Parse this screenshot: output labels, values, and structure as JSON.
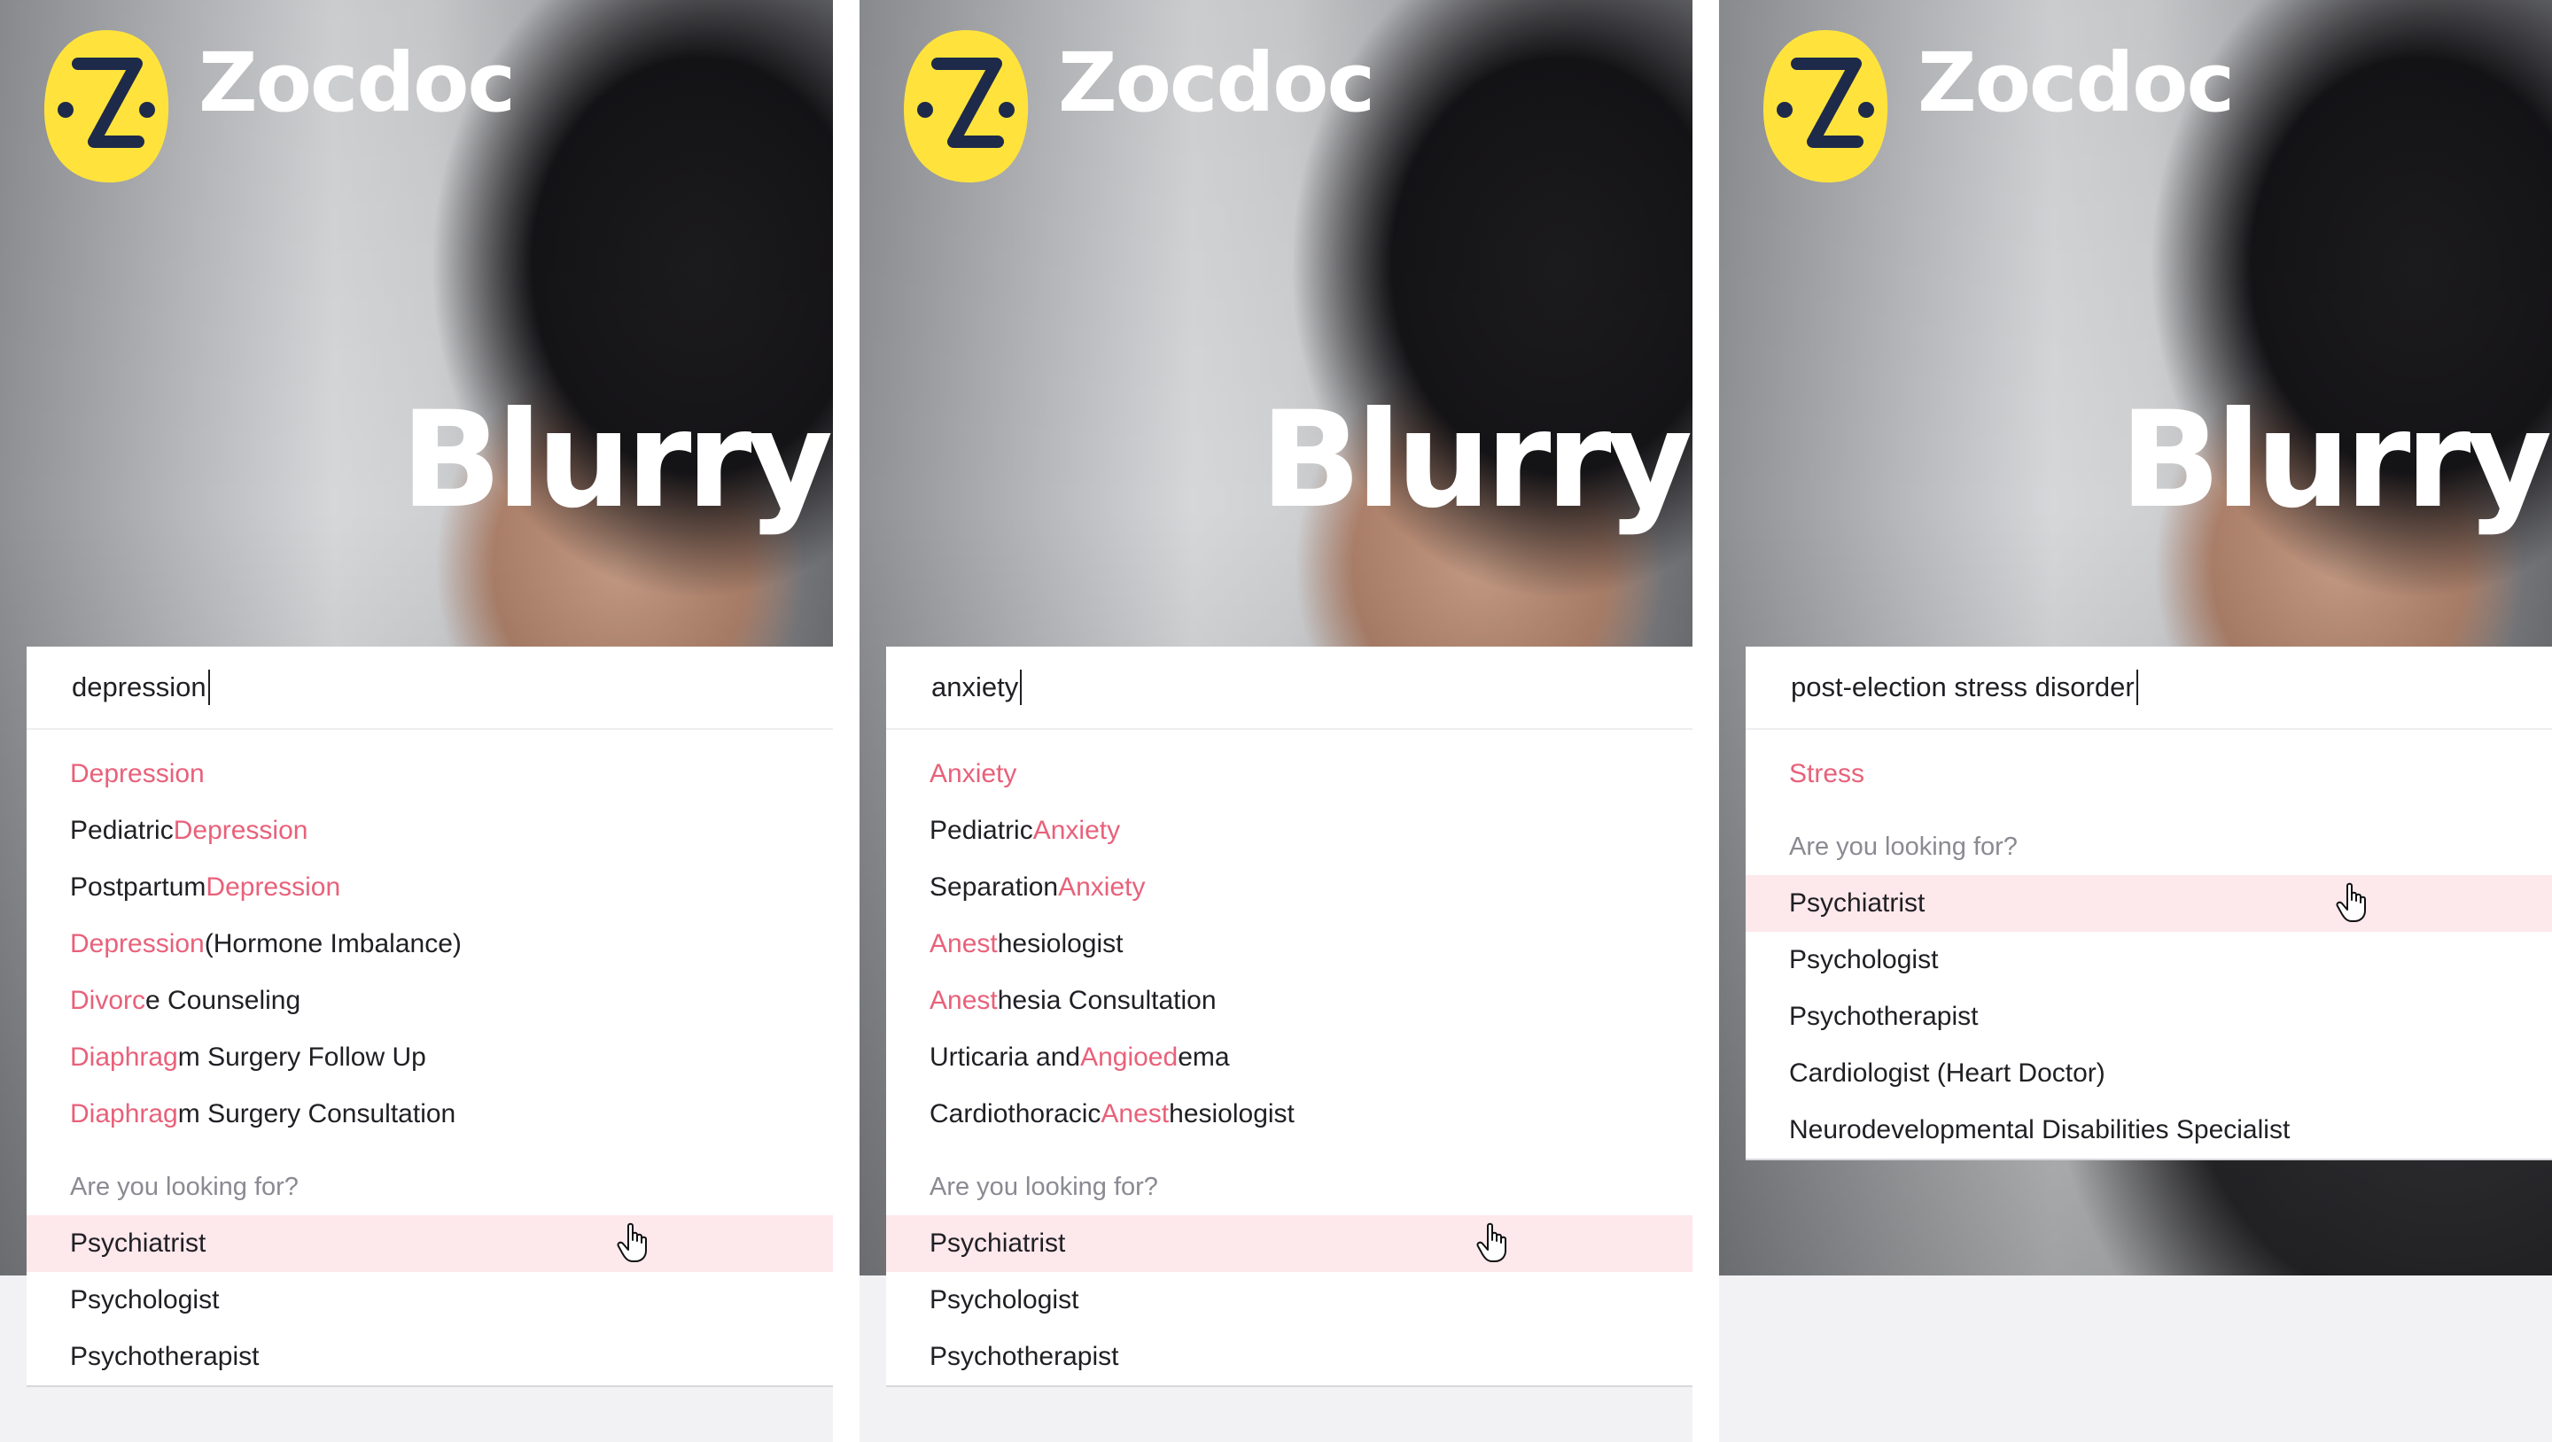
{
  "colors": {
    "logo_yellow": "#ffe33c",
    "logo_navy": "#1e2a4a",
    "match_pink": "#e8617a",
    "highlight_bg": "#fde8ec",
    "section_gray": "#8a8a92"
  },
  "brand": "Zocdoc",
  "headline": "Blurry?",
  "panels": [
    {
      "query": "depression",
      "results": [
        {
          "parts": [
            {
              "t": "Depression",
              "m": true
            }
          ]
        },
        {
          "parts": [
            {
              "t": "Pediatric ",
              "m": false
            },
            {
              "t": "Depression",
              "m": true
            }
          ]
        },
        {
          "parts": [
            {
              "t": "Postpartum ",
              "m": false
            },
            {
              "t": "Depression",
              "m": true
            }
          ]
        },
        {
          "parts": [
            {
              "t": "Depression",
              "m": true
            },
            {
              "t": " (Hormone Imbalance)",
              "m": false
            }
          ]
        },
        {
          "parts": [
            {
              "t": "Divorc",
              "m": true
            },
            {
              "t": "e Counseling",
              "m": false
            }
          ]
        },
        {
          "parts": [
            {
              "t": "Diaphrag",
              "m": true
            },
            {
              "t": "m Surgery Follow Up",
              "m": false
            }
          ]
        },
        {
          "parts": [
            {
              "t": "Diaphrag",
              "m": true
            },
            {
              "t": "m Surgery Consultation",
              "m": false
            }
          ]
        }
      ],
      "suggest_heading": "Are you looking for?",
      "suggestions": [
        "Psychiatrist",
        "Psychologist",
        "Psychotherapist"
      ],
      "highlighted_index": 0
    },
    {
      "query": "anxiety",
      "results": [
        {
          "parts": [
            {
              "t": "Anxiety",
              "m": true
            }
          ]
        },
        {
          "parts": [
            {
              "t": "Pediatric ",
              "m": false
            },
            {
              "t": "Anxiety",
              "m": true
            }
          ]
        },
        {
          "parts": [
            {
              "t": "Separation ",
              "m": false
            },
            {
              "t": "Anxiety",
              "m": true
            }
          ]
        },
        {
          "parts": [
            {
              "t": "Anest",
              "m": true
            },
            {
              "t": "hesiologist",
              "m": false
            }
          ]
        },
        {
          "parts": [
            {
              "t": "Anest",
              "m": true
            },
            {
              "t": "hesia Consultation",
              "m": false
            }
          ]
        },
        {
          "parts": [
            {
              "t": "Urticaria and ",
              "m": false
            },
            {
              "t": "Angioed",
              "m": true
            },
            {
              "t": "ema",
              "m": false
            }
          ]
        },
        {
          "parts": [
            {
              "t": "Cardiothoracic ",
              "m": false
            },
            {
              "t": "Anest",
              "m": true
            },
            {
              "t": "hesiologist",
              "m": false
            }
          ]
        }
      ],
      "suggest_heading": "Are you looking for?",
      "suggestions": [
        "Psychiatrist",
        "Psychologist",
        "Psychotherapist"
      ],
      "highlighted_index": 0
    },
    {
      "query": "post-election stress disorder",
      "results": [
        {
          "parts": [
            {
              "t": "Stress",
              "m": true
            }
          ]
        }
      ],
      "suggest_heading": "Are you looking for?",
      "suggestions": [
        "Psychiatrist",
        "Psychologist",
        "Psychotherapist",
        "Cardiologist (Heart Doctor)",
        "Neurodevelopmental Disabilities Specialist"
      ],
      "highlighted_index": 0
    }
  ]
}
